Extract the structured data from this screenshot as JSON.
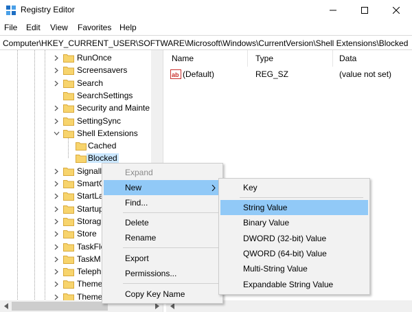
{
  "window": {
    "title": "Registry Editor",
    "icon": "registry-editor-icon"
  },
  "controls": {
    "minimize": "minimize-icon",
    "maximize": "maximize-icon",
    "close": "close-icon"
  },
  "menubar": [
    "File",
    "Edit",
    "View",
    "Favorites",
    "Help"
  ],
  "address": "Computer\\HKEY_CURRENT_USER\\SOFTWARE\\Microsoft\\Windows\\CurrentVersion\\Shell Extensions\\Blocked",
  "tree": {
    "items": [
      {
        "label": "RunOnce",
        "expander": ">"
      },
      {
        "label": "Screensavers",
        "expander": ">"
      },
      {
        "label": "Search",
        "expander": ">"
      },
      {
        "label": "SearchSettings",
        "expander": ""
      },
      {
        "label": "Security and Mainte",
        "expander": ">"
      },
      {
        "label": "SettingSync",
        "expander": ">"
      },
      {
        "label": "Shell Extensions",
        "expander": "v"
      },
      {
        "label": "Cached",
        "expander": ""
      },
      {
        "label": "Blocked",
        "expander": "",
        "selected": true
      },
      {
        "label": "Signall",
        "expander": ">"
      },
      {
        "label": "SmartG",
        "expander": ">"
      },
      {
        "label": "StartLa",
        "expander": ">"
      },
      {
        "label": "Startup",
        "expander": ">"
      },
      {
        "label": "Storag",
        "expander": ">"
      },
      {
        "label": "Store",
        "expander": ">"
      },
      {
        "label": "TaskFlo",
        "expander": ">"
      },
      {
        "label": "TaskM",
        "expander": ">"
      },
      {
        "label": "Teleph",
        "expander": ">"
      },
      {
        "label": "Theme",
        "expander": ">"
      },
      {
        "label": "Theme",
        "expander": ">"
      }
    ]
  },
  "list": {
    "columns": {
      "name": "Name",
      "type": "Type",
      "data": "Data"
    },
    "rows": [
      {
        "name": "(Default)",
        "type": "REG_SZ",
        "data": "(value not set)",
        "icon": "string-value-icon"
      }
    ]
  },
  "context_menu": {
    "items": [
      "Expand",
      "New",
      "Find...",
      "Delete",
      "Rename",
      "Export",
      "Permissions...",
      "Copy Key Name"
    ],
    "disabled": [
      "Expand"
    ],
    "highlighted": "New"
  },
  "submenu": {
    "items": [
      "Key",
      "String Value",
      "Binary Value",
      "DWORD (32-bit) Value",
      "QWORD (64-bit) Value",
      "Multi-String Value",
      "Expandable String Value"
    ],
    "highlighted": "String Value"
  },
  "colors": {
    "highlight": "#91c9f7",
    "menu_bg": "#f2f2f2",
    "folder": "#f7d46d",
    "selection": "#cce8ff"
  }
}
